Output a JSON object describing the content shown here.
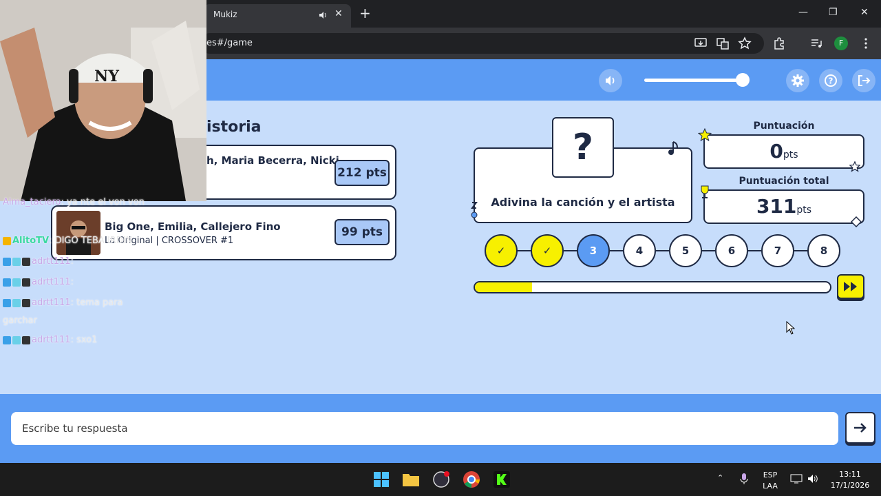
{
  "browser": {
    "tab_title": "Mukiz",
    "url": "es#/game",
    "avatar_letter": "F"
  },
  "history": {
    "title": "istoria",
    "items": [
      {
        "name": "h, Maria Becerra, Nicki",
        "sub": "",
        "pts": "212 pts"
      },
      {
        "name": "Big One, Emilia, Callejero Fino",
        "sub": "La Original | CROSSOVER #1",
        "pts": "99 pts"
      }
    ]
  },
  "game": {
    "mystery": "?",
    "prompt": "Adivina la canción y el artista",
    "score_label": "Puntuación",
    "score_value": "0",
    "score_unit": "pts",
    "total_label": "Puntuación total",
    "total_value": "311",
    "total_unit": "pts",
    "steps": [
      "✓",
      "✓",
      "3",
      "4",
      "5",
      "6",
      "7",
      "8"
    ],
    "progress": 0.16,
    "volume": 0.95
  },
  "answer": {
    "placeholder": "Escribe tu respuesta"
  },
  "chat": {
    "lines": [
      {
        "user": "Alma_taciero",
        "text": ": ya nte el von von"
      },
      {
        "user": "AlitoTV",
        "text": ": DIGO TEBA IRDIN"
      },
      {
        "user": "adrtt111",
        "text": ":"
      },
      {
        "user": "adrtt111",
        "text": ":"
      },
      {
        "user": "adrtt111",
        "text": ": tema para"
      },
      {
        "user": "",
        "text": "garchar"
      },
      {
        "user": "adrtt111",
        "text": ": sxo1"
      }
    ]
  },
  "taskbar": {
    "lang": "ESP",
    "layout": "LAA",
    "time": "13:11",
    "date": "17/1/2026"
  },
  "colors": {
    "accent_blue": "#5b9bf3",
    "page_bg": "#c7ddfb",
    "yellow": "#f7f000",
    "ink": "#1f2a44"
  }
}
